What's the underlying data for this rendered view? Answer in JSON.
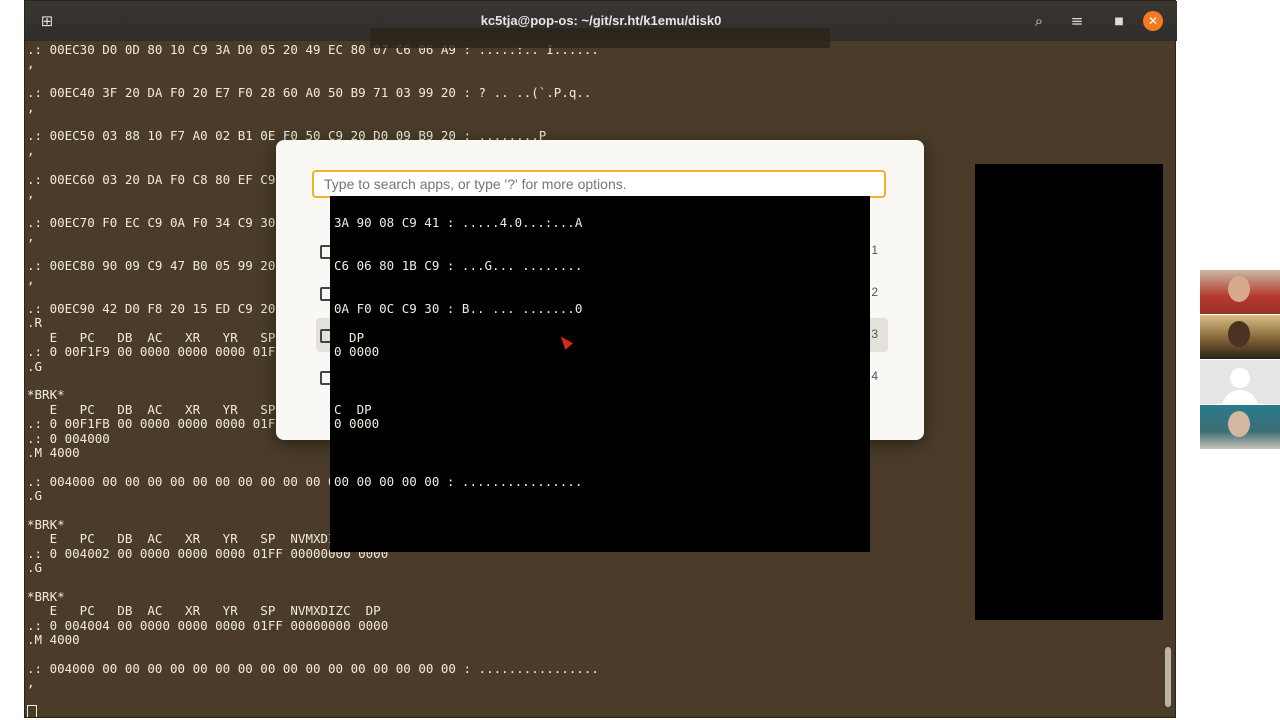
{
  "window": {
    "title": "kc5tja@pop-os: ~/git/sr.ht/k1emu/disk0",
    "newtab_icon": "new-tab-icon",
    "search_icon": "search-icon",
    "menu_icon": "hamburger-menu-icon",
    "maximize_icon": "maximize-icon",
    "close_icon": "close-icon"
  },
  "terminal": {
    "lines": [
      ".: 00EC30 D0 0D 80 10 C9 3A D0 05 20 49 EC 80 07 C6 06 A9 : .....:.. I......",
      ",",
      "",
      ".: 00EC40 3F 20 DA F0 20 E7 F0 28 60 A0 50 B9 71 03 99 20 : ? .. ..(`.P.q..",
      ",",
      "",
      ".: 00EC50 03 88 10 F7 A0 02 B1 0E F0 50 C9 20 D0 09 B9 20 : ........P",
      ",",
      "",
      ".: 00EC60 03 20 DA F0 C8 80 EF C9 5",
      ",",
      "",
      ".: 00EC70 F0 EC C9 0A F0 34 C9 30 9",
      ",",
      "",
      ".: 00EC80 90 09 C9 47 B0 05 99 20 0",
      ",",
      "",
      ".: 00EC90 42 D0 F8 20 15 ED C9 20 F",
      ".R",
      "   E   PC   DB  AC   XR   YR   SP",
      ".: 0 00F1F9 00 0000 0000 0000 01FF",
      ".G",
      "",
      "*BRK*",
      "   E   PC   DB  AC   XR   YR   SP",
      ".: 0 00F1FB 00 0000 0000 0000 01FF",
      ".: 0 004000",
      ".M 4000",
      "",
      ".: 004000 00 00 00 00 00 00 00 00 00 00 00 00 00 00 00 00 : ................",
      ".G",
      "",
      "*BRK*",
      "   E   PC   DB  AC   XR   YR   SP  NVMXDIZC  DP",
      ".: 0 004002 00 0000 0000 0000 01FF 00000000 0000",
      ".G",
      "",
      "*BRK*",
      "   E   PC   DB  AC   XR   YR   SP  NVMXDIZC  DP",
      ".: 0 004004 00 0000 0000 0000 01FF 00000000 0000",
      ".M 4000",
      "",
      ".: 004000 00 00 00 00 00 00 00 00 00 00 00 00 00 00 00 00 : ................",
      ",",
      ""
    ]
  },
  "launcher": {
    "placeholder": "Type to search apps, or type '?' for more options.",
    "items": [
      {
        "num": "1"
      },
      {
        "num": "2"
      },
      {
        "num": "3"
      },
      {
        "num": "4"
      }
    ]
  },
  "overlay": {
    "lines": [
      {
        "text": "3A 90 08 C9 41 : .....4.0...:...A"
      },
      {
        "text": "C6 06 80 1B C9 : ...G... ........"
      },
      {
        "text": "0A F0 0C C9 30 : B.. ... .......0"
      },
      {
        "text": "  DP"
      },
      {
        "text": "0 0000"
      },
      {
        "text": "C  DP"
      },
      {
        "text": "0 0000"
      },
      {
        "text": "00 00 00 00 00 : ................"
      }
    ]
  },
  "video_call": {
    "participants": [
      "participant-1",
      "participant-2",
      "participant-3",
      "participant-4"
    ]
  },
  "colors": {
    "terminal_bg": "#4a3c28",
    "accent": "#f3b02c",
    "close": "#f47a22"
  }
}
